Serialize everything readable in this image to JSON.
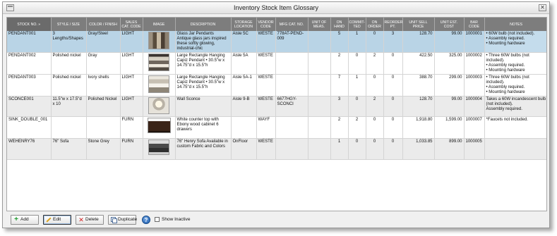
{
  "window": {
    "title": "Inventory Stock Item Glossary",
    "close_glyph": "✕"
  },
  "table": {
    "columns": [
      "STOCK NO. »",
      "STYLE / SIZE",
      "COLOR / FINISH",
      "SALES CAT. CODE",
      "IMAGE",
      "DESCRIPTION",
      "STORAGE LOCATION",
      "VENDOR CODE",
      "MFG CAT. NO.",
      "UNIT OF MEAS.",
      "ON HAND",
      "COMMIT-TED",
      "ON ORDER",
      "REORDER PT.",
      "UNIT SELL PRICE",
      "UNIT EST. COST",
      "BAR CODE",
      "NOTES"
    ],
    "rows": [
      {
        "stock_no": "PENDANT001",
        "style": "3 Lengths/Shapes",
        "color": "Gray/Steel",
        "sales_cat": "LIGHT",
        "image": "glass-jar-pendants-photo",
        "description": "Glass Jar Pendants Antique glass jars inspired these softly glowing, industrial-chic",
        "storage": "Aisle 5C",
        "vendor": "WESTE",
        "mfg_cat": "778AT-PEND-009",
        "uom": "",
        "on_hand": "5",
        "committed": "1",
        "on_order": "0",
        "reorder": "3",
        "sell_price": "128.70",
        "est_cost": "99.00",
        "bar_code": "1000001",
        "notes": [
          "• 60W bulb (not included).",
          "• Assembly required.",
          "• Mounting hardware"
        ]
      },
      {
        "stock_no": "PENDANT002",
        "style": "Polished nickel",
        "color": "Gray",
        "sales_cat": "LIGHT",
        "image": "rectangle-pendant-photo",
        "description": "Large Rectangle Hanging Capiz Pendant • 30.5\"w x 14.75\"d x 15.5\"h",
        "storage": "Aisle 5A",
        "vendor": "WESTE",
        "mfg_cat": "",
        "uom": "",
        "on_hand": "2",
        "committed": "0",
        "on_order": "2",
        "reorder": "0",
        "sell_price": "422.50",
        "est_cost": "325.00",
        "bar_code": "1000002",
        "notes": [
          "• Three 60W bulbs (not included).",
          "• Assembly required.",
          "• Mounting hardware"
        ]
      },
      {
        "stock_no": "PENDANT003",
        "style": "Polished nickel",
        "color": "Ivory shells",
        "sales_cat": "LIGHT",
        "image": "capiz-pendant-photo",
        "description": "Large Rectangle Hanging Capiz Pendant • 30.5\"w x 14.75\"d x 15.5\"h",
        "storage": "Aisle 5A-1",
        "vendor": "WESTE",
        "mfg_cat": "",
        "uom": "",
        "on_hand": "7",
        "committed": "1",
        "on_order": "0",
        "reorder": "0",
        "sell_price": "388.70",
        "est_cost": "299.00",
        "bar_code": "1000003",
        "notes": [
          "• Three 60W bulbs (not included).",
          "• Assembly required.",
          "• Mounting hardware"
        ]
      },
      {
        "stock_no": "SCONCE001",
        "style": "11.5\"w x 17.5\"d x 10",
        "color": "Polished Nickel",
        "sales_cat": "LIGHT",
        "image": "wall-sconce-photo",
        "description": "Wall Sconce",
        "storage": "Aisle 9-B",
        "vendor": "WESTE",
        "mfg_cat": "6677HGY-SCONCI",
        "uom": "",
        "on_hand": "3",
        "committed": "0",
        "on_order": "2",
        "reorder": "0",
        "sell_price": "128.70",
        "est_cost": "99.00",
        "bar_code": "1000004",
        "notes": [
          "Takes a 60W incandescent bulb (not included).",
          "Assembly required."
        ]
      },
      {
        "stock_no": "SINK_DOUBLE_001",
        "style": "",
        "color": "",
        "sales_cat": "FURN",
        "image": "sink-cabinet-photo",
        "description": "White counter top with Ebony wood cabinet 6 drawers",
        "storage": "",
        "vendor": "WAYF",
        "mfg_cat": "",
        "uom": "",
        "on_hand": "2",
        "committed": "2",
        "on_order": "0",
        "reorder": "0",
        "sell_price": "1,918.80",
        "est_cost": "1,599.00",
        "bar_code": "1000007",
        "notes": [
          "*Faucets not included."
        ]
      },
      {
        "stock_no": "WEHENRY76",
        "style": "76\" Sofa",
        "color": "Stone Grey",
        "sales_cat": "FURN",
        "image": "sofa-photo",
        "description": "76\" Henry Sofa Available in custom Fabric and Colors",
        "storage": "OnFloor",
        "vendor": "WESTE",
        "mfg_cat": "",
        "uom": "",
        "on_hand": "1",
        "committed": "0",
        "on_order": "0",
        "reorder": "0",
        "sell_price": "1,033.85",
        "est_cost": "899.00",
        "bar_code": "1000005",
        "notes": []
      }
    ]
  },
  "toolbar": {
    "add_label": "Add",
    "edit_label": "Edit",
    "delete_label": "Delete",
    "duplicate_label": "Duplicate",
    "help_glyph": "?",
    "show_inactive_label": "Show Inactive"
  },
  "colors": {
    "header_bg": "#7d7d7d",
    "selected_row": "#b9d4e6",
    "alt_row": "#ebebeb"
  }
}
